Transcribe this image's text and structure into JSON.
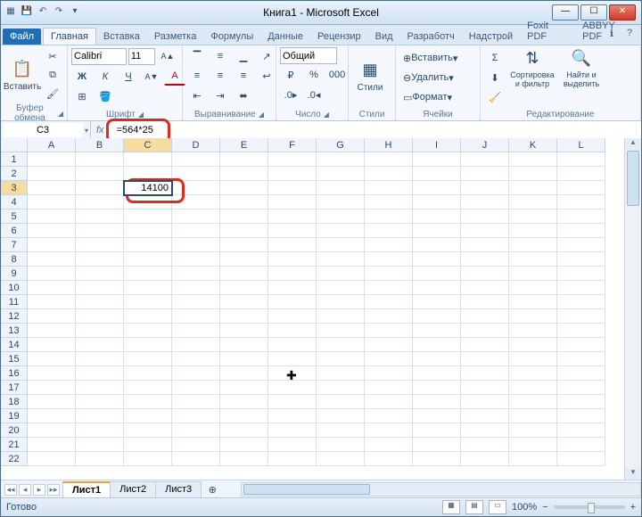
{
  "title": "Книга1 - Microsoft Excel",
  "qat": {
    "save": "💾",
    "undo": "↶",
    "redo": "↷"
  },
  "winbtns": {
    "min": "—",
    "max": "☐",
    "close": "✕"
  },
  "tabs": {
    "file": "Файл",
    "items": [
      "Главная",
      "Вставка",
      "Разметка",
      "Формулы",
      "Данные",
      "Рецензир",
      "Вид",
      "Разработч",
      "Надстрой",
      "Foxit PDF",
      "ABBYY PDF"
    ],
    "active": 0
  },
  "help": {
    "info": "ℹ",
    "q": "?"
  },
  "ribbon": {
    "clipboard": {
      "label": "Буфер обмена",
      "paste": "Вставить",
      "paste_icon": "📋",
      "cut": "✂",
      "copy": "⧉",
      "brush": "🖌"
    },
    "font": {
      "label": "Шрифт",
      "name": "Calibri",
      "size": "11",
      "incr": "A▲",
      "decr": "A▼",
      "bold": "Ж",
      "italic": "К",
      "under": "Ч",
      "border": "⊞",
      "fill": "🪣",
      "color": "A"
    },
    "align": {
      "label": "Выравнивание",
      "top": "⬆",
      "mid": "≡",
      "bot": "⬇",
      "l": "≡",
      "c": "≡",
      "r": "≡",
      "wrap": "↩",
      "merge": "⬌",
      "indm": "⇤",
      "indp": "⇥",
      "orient": "↗"
    },
    "number": {
      "label": "Число",
      "fmt": "Общий",
      "cur": "₽",
      "pct": "%",
      "comma": ",",
      "decm": "⁺",
      "decl": "⁻"
    },
    "styles": {
      "label": "Стили",
      "btn": "Стили",
      "cond": "▦"
    },
    "cells": {
      "label": "Ячейки",
      "ins": "Вставить",
      "del": "Удалить",
      "fmt": "Формат",
      "ins_i": "⊕",
      "del_i": "⊖",
      "fmt_i": "▭"
    },
    "editing": {
      "label": "Редактирование",
      "sort": "Сортировка и фильтр",
      "find": "Найти и выделить",
      "sum": "Σ",
      "fill": "⬇",
      "clear": "🧹",
      "sort_i": "⇅",
      "find_i": "🔍"
    }
  },
  "namebox": "C3",
  "formula": "=564*25",
  "columns": [
    "A",
    "B",
    "C",
    "D",
    "E",
    "F",
    "G",
    "H",
    "I",
    "J",
    "K",
    "L"
  ],
  "active_col": "C",
  "active_row": 3,
  "cells": {
    "C3": "14100"
  },
  "sheets": {
    "nav": [
      "◂◂",
      "◂",
      "▸",
      "▸▸"
    ],
    "items": [
      "Лист1",
      "Лист2",
      "Лист3"
    ],
    "active": 0,
    "new": "⊕"
  },
  "status": {
    "ready": "Готово",
    "zoom": "100%",
    "minus": "−",
    "plus": "+"
  }
}
